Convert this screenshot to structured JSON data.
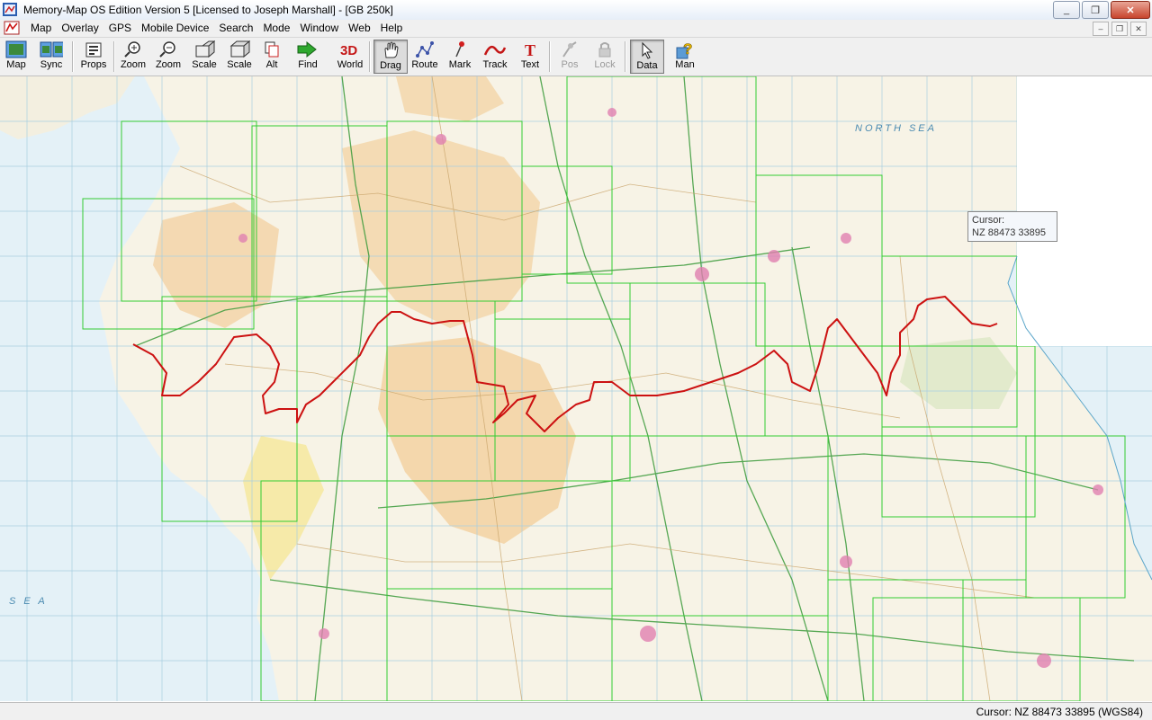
{
  "window": {
    "title": "Memory-Map OS Edition Version 5 [Licensed to Joseph Marshall] - [GB 250k]",
    "controls": [
      "_",
      "❐",
      "✕"
    ]
  },
  "menu": [
    "Map",
    "Overlay",
    "GPS",
    "Mobile Device",
    "Search",
    "Mode",
    "Window",
    "Web",
    "Help"
  ],
  "mdi_controls": [
    "–",
    "❐",
    "✕"
  ],
  "toolbar": {
    "map": "Map",
    "sync": "Sync",
    "props": "Props",
    "zoom_in": "Zoom",
    "zoom_out": "Zoom",
    "scale_up": "Scale",
    "scale_down": "Scale",
    "alt": "Alt",
    "find": "Find",
    "world": "World",
    "drag": "Drag",
    "route": "Route",
    "mark": "Mark",
    "track": "Track",
    "text": "Text",
    "pos": "Pos",
    "lock": "Lock",
    "data": "Data",
    "man": "Man"
  },
  "map": {
    "labels": {
      "north_sea": "NORTH SEA",
      "sea": "S E A"
    },
    "tooltip": {
      "title": "Cursor:",
      "value": "NZ 88473 33895"
    },
    "colors": {
      "sea": "#e4f1f7",
      "land": "#f7f3e6",
      "upland": "#f3d9b0",
      "grid": "#33cc33",
      "route": "#cc1111"
    }
  },
  "status": {
    "cursor": "Cursor: NZ 88473 33895 (WGS84)"
  }
}
